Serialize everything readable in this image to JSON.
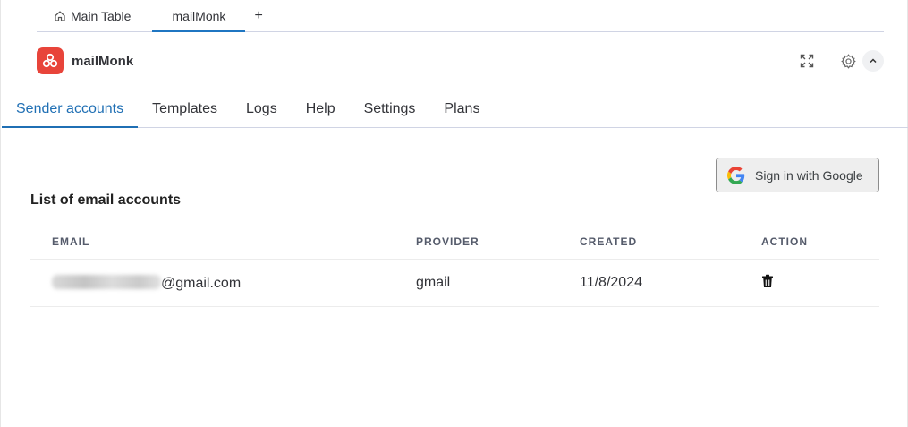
{
  "board_tabs": [
    {
      "label": "Main Table",
      "icon": "home-icon"
    },
    {
      "label": "mailMonk"
    }
  ],
  "add_tab_label": "+",
  "app": {
    "name": "mailMonk",
    "brand_color": "#e8443a",
    "accent_color": "#1f6fb4"
  },
  "app_tabs": [
    "Sender accounts",
    "Templates",
    "Logs",
    "Help",
    "Settings",
    "Plans"
  ],
  "active_app_tab": "Sender accounts",
  "google_button": {
    "label": "Sign in with Google",
    "icon": "google-g-icon"
  },
  "section_title": "List of email accounts",
  "table": {
    "headers": {
      "email": "EMAIL",
      "provider": "PROVIDER",
      "created": "CREATED",
      "action": "ACTION"
    },
    "rows": [
      {
        "email_visible": "@gmail.com",
        "provider": "gmail",
        "created": "11/8/2024",
        "action_icon": "trash-icon"
      }
    ]
  }
}
